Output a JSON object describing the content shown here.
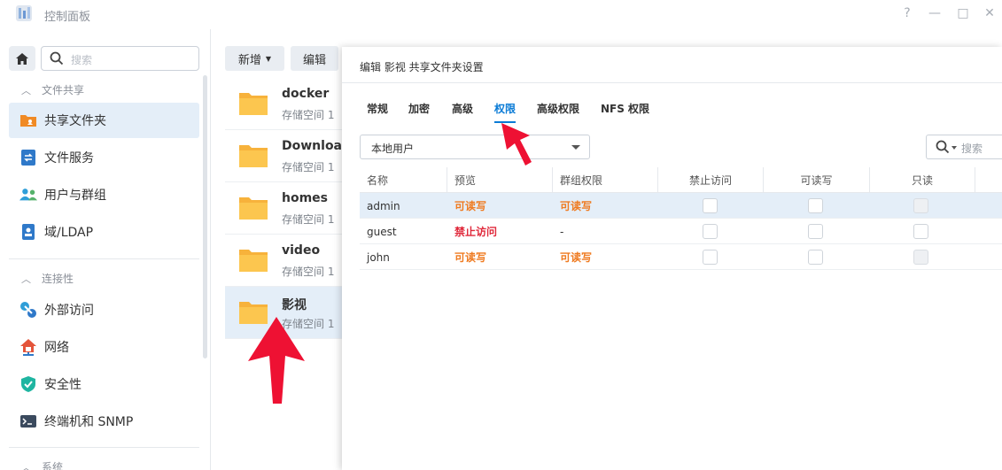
{
  "window": {
    "title": "控制面板",
    "controls": [
      "?",
      "—",
      "□",
      "✕"
    ]
  },
  "sidebar": {
    "search_placeholder": "搜索",
    "sections": [
      {
        "label": "文件共享",
        "items": [
          {
            "label": "共享文件夹",
            "icon": "shared-folder-icon",
            "active": true
          },
          {
            "label": "文件服务",
            "icon": "file-services-icon"
          },
          {
            "label": "用户与群组",
            "icon": "users-groups-icon"
          },
          {
            "label": "域/LDAP",
            "icon": "domain-ldap-icon"
          }
        ]
      },
      {
        "label": "连接性",
        "items": [
          {
            "label": "外部访问",
            "icon": "external-access-icon"
          },
          {
            "label": "网络",
            "icon": "network-icon"
          },
          {
            "label": "安全性",
            "icon": "security-shield-icon"
          },
          {
            "label": "终端机和 SNMP",
            "icon": "terminal-icon"
          }
        ]
      },
      {
        "label": "系统",
        "items": []
      }
    ]
  },
  "main": {
    "toolbar": {
      "create_label": "新增",
      "edit_label": "编辑"
    },
    "folders": [
      {
        "name": "docker",
        "sub": "存储空间 1"
      },
      {
        "name": "Download",
        "sub": "存储空间 1"
      },
      {
        "name": "homes",
        "sub": "存储空间 1"
      },
      {
        "name": "video",
        "sub": "存储空间 1"
      },
      {
        "name": "影视",
        "sub": "存储空间 1",
        "selected": true
      }
    ]
  },
  "dialog": {
    "title": "编辑 影视 共享文件夹设置",
    "tabs": [
      "常规",
      "加密",
      "高级",
      "权限",
      "高级权限",
      "NFS 权限"
    ],
    "active_tab": "权限",
    "user_type_select": "本地用户",
    "search_placeholder": "搜索",
    "columns": [
      "名称",
      "预览",
      "群组权限",
      "禁止访问",
      "可读写",
      "只读"
    ],
    "rows": [
      {
        "name": "admin",
        "preview": "可读写",
        "group": "可读写",
        "selected": true
      },
      {
        "name": "guest",
        "preview": "禁止访问",
        "group": "-"
      },
      {
        "name": "john",
        "preview": "可读写",
        "group": "可读写"
      }
    ]
  },
  "colors": {
    "accent": "#0a7bd6",
    "read_write": "#ef7b21",
    "no_access": "#e02a3c",
    "selection": "#e4eef8",
    "annotation_arrow": "#ee1133"
  }
}
